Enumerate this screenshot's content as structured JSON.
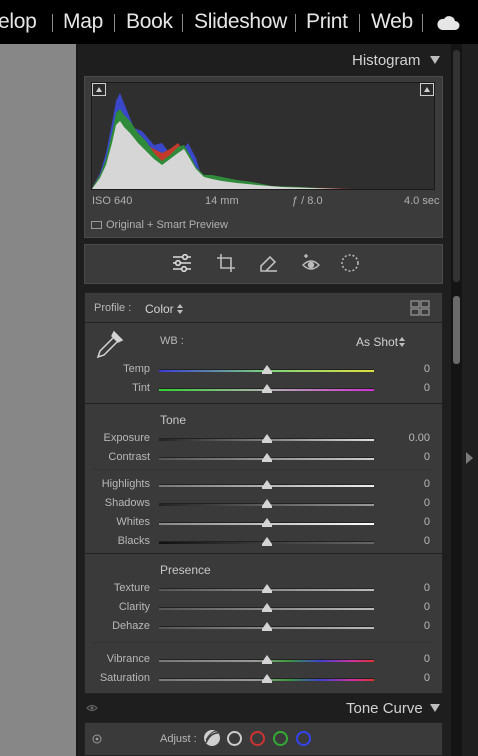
{
  "topbar": {
    "modules": [
      "elop",
      "Map",
      "Book",
      "Slideshow",
      "Print",
      "Web"
    ],
    "cloud_icon": "cloud-icon"
  },
  "histogram": {
    "title": "Histogram",
    "iso": "ISO 640",
    "focal_length": "14 mm",
    "aperture": "ƒ / 8.0",
    "shutter": "4.0 sec",
    "preview_label": "Original + Smart Preview"
  },
  "tools": [
    "edit-sliders-icon",
    "crop-icon",
    "healing-icon",
    "red-eye-icon",
    "masking-icon"
  ],
  "basic": {
    "profile_label": "Profile :",
    "profile_value": "Color",
    "wb_label": "WB :",
    "wb_value": "As Shot",
    "wb_sliders": [
      {
        "label": "Temp",
        "value": "0"
      },
      {
        "label": "Tint",
        "value": "0"
      }
    ],
    "tone_title": "Tone",
    "tone_sliders_a": [
      {
        "label": "Exposure",
        "value": "0.00"
      },
      {
        "label": "Contrast",
        "value": "0"
      }
    ],
    "tone_sliders_b": [
      {
        "label": "Highlights",
        "value": "0"
      },
      {
        "label": "Shadows",
        "value": "0"
      },
      {
        "label": "Whites",
        "value": "0"
      },
      {
        "label": "Blacks",
        "value": "0"
      }
    ],
    "presence_title": "Presence",
    "presence_sliders_a": [
      {
        "label": "Texture",
        "value": "0"
      },
      {
        "label": "Clarity",
        "value": "0"
      },
      {
        "label": "Dehaze",
        "value": "0"
      }
    ],
    "presence_sliders_b": [
      {
        "label": "Vibrance",
        "value": "0"
      },
      {
        "label": "Saturation",
        "value": "0"
      }
    ]
  },
  "tone_curve": {
    "title": "Tone Curve",
    "adjust_label": "Adjust :",
    "channels": [
      "parametric",
      "white",
      "red",
      "green",
      "blue"
    ],
    "channel_colors": [
      "#cccccc",
      "#cc3333",
      "#33aa33",
      "#3344ee"
    ]
  }
}
